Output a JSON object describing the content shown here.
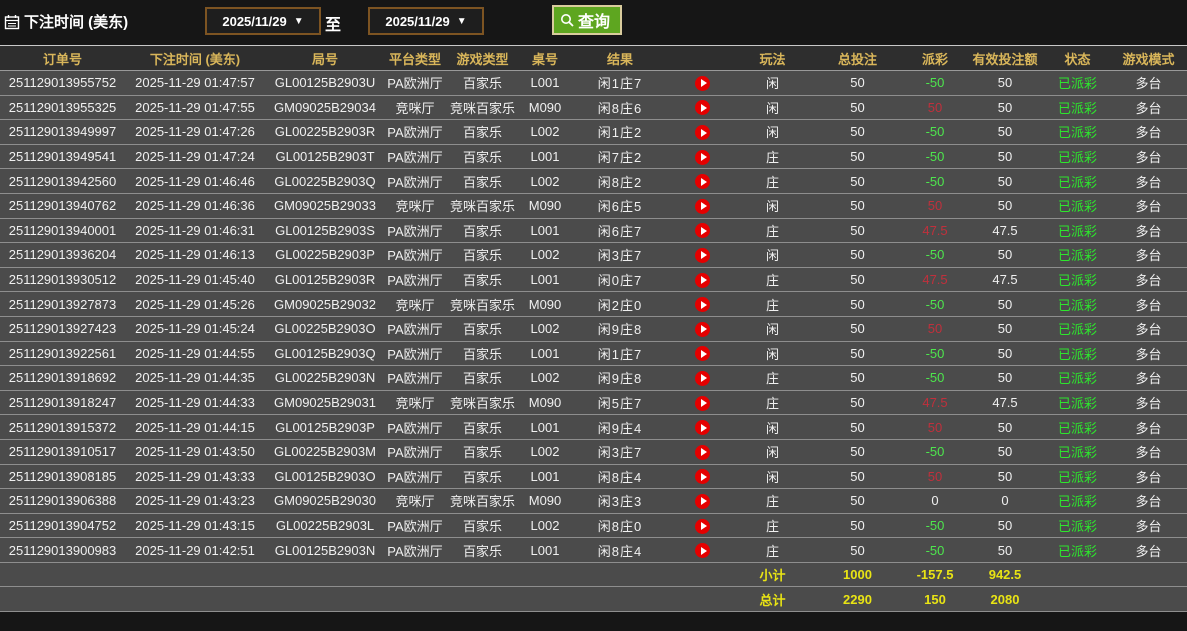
{
  "toolbar": {
    "title": "下注时间 (美东)",
    "date_from": "2025/11/29",
    "date_to": "2025/11/29",
    "to_label": "至",
    "query_label": "查询",
    "caret": "▼"
  },
  "colors": {
    "payout_positive": "#c0303c",
    "payout_negative": "#4de64d",
    "status_green": "#2de62d",
    "header_gold": "#d9b65a",
    "footer_yellow": "#e9e414",
    "query_green": "#5ea620",
    "play_red": "#e40000"
  },
  "table": {
    "headers": [
      "订单号",
      "下注时间 (美东)",
      "局号",
      "平台类型",
      "游戏类型",
      "桌号",
      "结果",
      "",
      "玩法",
      "总投注",
      "派彩",
      "有效投注额",
      "状态",
      "游戏模式"
    ],
    "rows": [
      {
        "order": "251129013955752",
        "time": "2025-11-29 01:47:57",
        "round": "GL00125B2903U",
        "platform": "PA欧洲厅",
        "game": "百家乐",
        "table_no": "L001",
        "result": "闲1庄7",
        "side": "闲",
        "total_bet": "50",
        "payout": "-50",
        "valid_bet": "50",
        "status": "已派彩",
        "mode": "多台"
      },
      {
        "order": "251129013955325",
        "time": "2025-11-29 01:47:55",
        "round": "GM09025B29034",
        "platform": "竞咪厅",
        "game": "竞咪百家乐",
        "table_no": "M090",
        "result": "闲8庄6",
        "side": "闲",
        "total_bet": "50",
        "payout": "50",
        "valid_bet": "50",
        "status": "已派彩",
        "mode": "多台"
      },
      {
        "order": "251129013949997",
        "time": "2025-11-29 01:47:26",
        "round": "GL00225B2903R",
        "platform": "PA欧洲厅",
        "game": "百家乐",
        "table_no": "L002",
        "result": "闲1庄2",
        "side": "闲",
        "total_bet": "50",
        "payout": "-50",
        "valid_bet": "50",
        "status": "已派彩",
        "mode": "多台"
      },
      {
        "order": "251129013949541",
        "time": "2025-11-29 01:47:24",
        "round": "GL00125B2903T",
        "platform": "PA欧洲厅",
        "game": "百家乐",
        "table_no": "L001",
        "result": "闲7庄2",
        "side": "庄",
        "total_bet": "50",
        "payout": "-50",
        "valid_bet": "50",
        "status": "已派彩",
        "mode": "多台"
      },
      {
        "order": "251129013942560",
        "time": "2025-11-29 01:46:46",
        "round": "GL00225B2903Q",
        "platform": "PA欧洲厅",
        "game": "百家乐",
        "table_no": "L002",
        "result": "闲8庄2",
        "side": "庄",
        "total_bet": "50",
        "payout": "-50",
        "valid_bet": "50",
        "status": "已派彩",
        "mode": "多台"
      },
      {
        "order": "251129013940762",
        "time": "2025-11-29 01:46:36",
        "round": "GM09025B29033",
        "platform": "竞咪厅",
        "game": "竞咪百家乐",
        "table_no": "M090",
        "result": "闲6庄5",
        "side": "闲",
        "total_bet": "50",
        "payout": "50",
        "valid_bet": "50",
        "status": "已派彩",
        "mode": "多台"
      },
      {
        "order": "251129013940001",
        "time": "2025-11-29 01:46:31",
        "round": "GL00125B2903S",
        "platform": "PA欧洲厅",
        "game": "百家乐",
        "table_no": "L001",
        "result": "闲6庄7",
        "side": "庄",
        "total_bet": "50",
        "payout": "47.5",
        "valid_bet": "47.5",
        "status": "已派彩",
        "mode": "多台"
      },
      {
        "order": "251129013936204",
        "time": "2025-11-29 01:46:13",
        "round": "GL00225B2903P",
        "platform": "PA欧洲厅",
        "game": "百家乐",
        "table_no": "L002",
        "result": "闲3庄7",
        "side": "闲",
        "total_bet": "50",
        "payout": "-50",
        "valid_bet": "50",
        "status": "已派彩",
        "mode": "多台"
      },
      {
        "order": "251129013930512",
        "time": "2025-11-29 01:45:40",
        "round": "GL00125B2903R",
        "platform": "PA欧洲厅",
        "game": "百家乐",
        "table_no": "L001",
        "result": "闲0庄7",
        "side": "庄",
        "total_bet": "50",
        "payout": "47.5",
        "valid_bet": "47.5",
        "status": "已派彩",
        "mode": "多台"
      },
      {
        "order": "251129013927873",
        "time": "2025-11-29 01:45:26",
        "round": "GM09025B29032",
        "platform": "竞咪厅",
        "game": "竞咪百家乐",
        "table_no": "M090",
        "result": "闲2庄0",
        "side": "庄",
        "total_bet": "50",
        "payout": "-50",
        "valid_bet": "50",
        "status": "已派彩",
        "mode": "多台"
      },
      {
        "order": "251129013927423",
        "time": "2025-11-29 01:45:24",
        "round": "GL00225B2903O",
        "platform": "PA欧洲厅",
        "game": "百家乐",
        "table_no": "L002",
        "result": "闲9庄8",
        "side": "闲",
        "total_bet": "50",
        "payout": "50",
        "valid_bet": "50",
        "status": "已派彩",
        "mode": "多台"
      },
      {
        "order": "251129013922561",
        "time": "2025-11-29 01:44:55",
        "round": "GL00125B2903Q",
        "platform": "PA欧洲厅",
        "game": "百家乐",
        "table_no": "L001",
        "result": "闲1庄7",
        "side": "闲",
        "total_bet": "50",
        "payout": "-50",
        "valid_bet": "50",
        "status": "已派彩",
        "mode": "多台"
      },
      {
        "order": "251129013918692",
        "time": "2025-11-29 01:44:35",
        "round": "GL00225B2903N",
        "platform": "PA欧洲厅",
        "game": "百家乐",
        "table_no": "L002",
        "result": "闲9庄8",
        "side": "庄",
        "total_bet": "50",
        "payout": "-50",
        "valid_bet": "50",
        "status": "已派彩",
        "mode": "多台"
      },
      {
        "order": "251129013918247",
        "time": "2025-11-29 01:44:33",
        "round": "GM09025B29031",
        "platform": "竞咪厅",
        "game": "竞咪百家乐",
        "table_no": "M090",
        "result": "闲5庄7",
        "side": "庄",
        "total_bet": "50",
        "payout": "47.5",
        "valid_bet": "47.5",
        "status": "已派彩",
        "mode": "多台"
      },
      {
        "order": "251129013915372",
        "time": "2025-11-29 01:44:15",
        "round": "GL00125B2903P",
        "platform": "PA欧洲厅",
        "game": "百家乐",
        "table_no": "L001",
        "result": "闲9庄4",
        "side": "闲",
        "total_bet": "50",
        "payout": "50",
        "valid_bet": "50",
        "status": "已派彩",
        "mode": "多台"
      },
      {
        "order": "251129013910517",
        "time": "2025-11-29 01:43:50",
        "round": "GL00225B2903M",
        "platform": "PA欧洲厅",
        "game": "百家乐",
        "table_no": "L002",
        "result": "闲3庄7",
        "side": "闲",
        "total_bet": "50",
        "payout": "-50",
        "valid_bet": "50",
        "status": "已派彩",
        "mode": "多台"
      },
      {
        "order": "251129013908185",
        "time": "2025-11-29 01:43:33",
        "round": "GL00125B2903O",
        "platform": "PA欧洲厅",
        "game": "百家乐",
        "table_no": "L001",
        "result": "闲8庄4",
        "side": "闲",
        "total_bet": "50",
        "payout": "50",
        "valid_bet": "50",
        "status": "已派彩",
        "mode": "多台"
      },
      {
        "order": "251129013906388",
        "time": "2025-11-29 01:43:23",
        "round": "GM09025B29030",
        "platform": "竞咪厅",
        "game": "竞咪百家乐",
        "table_no": "M090",
        "result": "闲3庄3",
        "side": "庄",
        "total_bet": "50",
        "payout": "0",
        "valid_bet": "0",
        "status": "已派彩",
        "mode": "多台"
      },
      {
        "order": "251129013904752",
        "time": "2025-11-29 01:43:15",
        "round": "GL00225B2903L",
        "platform": "PA欧洲厅",
        "game": "百家乐",
        "table_no": "L002",
        "result": "闲8庄0",
        "side": "庄",
        "total_bet": "50",
        "payout": "-50",
        "valid_bet": "50",
        "status": "已派彩",
        "mode": "多台"
      },
      {
        "order": "251129013900983",
        "time": "2025-11-29 01:42:51",
        "round": "GL00125B2903N",
        "platform": "PA欧洲厅",
        "game": "百家乐",
        "table_no": "L001",
        "result": "闲8庄4",
        "side": "庄",
        "total_bet": "50",
        "payout": "-50",
        "valid_bet": "50",
        "status": "已派彩",
        "mode": "多台"
      }
    ],
    "footer": {
      "subtotal": {
        "label": "小计",
        "total_bet": "1000",
        "payout": "-157.5",
        "valid_bet": "942.5"
      },
      "total": {
        "label": "总计",
        "total_bet": "2290",
        "payout": "150",
        "valid_bet": "2080"
      }
    }
  }
}
